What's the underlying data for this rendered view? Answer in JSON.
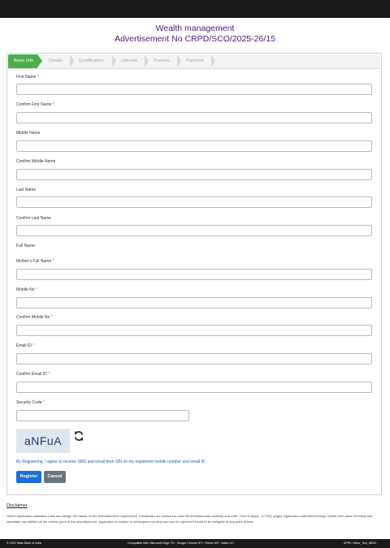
{
  "header": {
    "title_line1": "Wealth management",
    "title_line2": "Advertisement No CRPD/SCO/2025-26/15"
  },
  "steps": [
    "Basic Info",
    "Details",
    "Qualification",
    "Uploads",
    "Preview",
    "Payment"
  ],
  "form": {
    "first_name": "First Name",
    "confirm_first_name": "Confirm First Name",
    "middle_name": "Middle Name",
    "confirm_middle_name": "Confirm Middle Name",
    "last_name": "Last Name",
    "confirm_last_name": "Confirm Last Name",
    "full_name": "Full Name:",
    "mothers_full_name": "Mother's Full Name",
    "mobile_no": "Mobile No",
    "confirm_mobile_no": "Confirm Mobile No",
    "email_id": "Email ID",
    "confirm_email_id": "Confirm Email ID",
    "security_code": "Security Code",
    "required_mark": "*"
  },
  "captcha": {
    "text": "aNFuA",
    "refresh_icon": "refresh-icon"
  },
  "consent": "By Registering, I agree to receive SMS and email from SBI on my registered mobile number and email ID",
  "buttons": {
    "register": "Register",
    "cancel": "Cancel"
  },
  "disclaimer": {
    "heading": "Disclaimer",
    "text": "Online Application validation rules and design are based on the Advertisement requirement. Candidates are advised to read the advertisement carefully and refer ' How to Apply ' & 'FAQ' pages. Application submitted through Online form does not imply that candidate has fulfilled all the criteria given in the advertisement. Application is subject to subsequent scrutiny and can be rejected if found to be ineligible at any point of time."
  },
  "footer": {
    "copyright": "© 2022 State Bank of India",
    "compat": "Compatible with: Microsoft Edge 79+, Google Chrome 57+, Firefox 59+, Safari 11+",
    "version": "APRC Video_Test_ABSC"
  },
  "colors": {
    "step_active": "#4cae4c",
    "title": "#4a1a7a",
    "register": "#1a6fd9",
    "cancel": "#6c757d",
    "required": "#d9534f"
  }
}
